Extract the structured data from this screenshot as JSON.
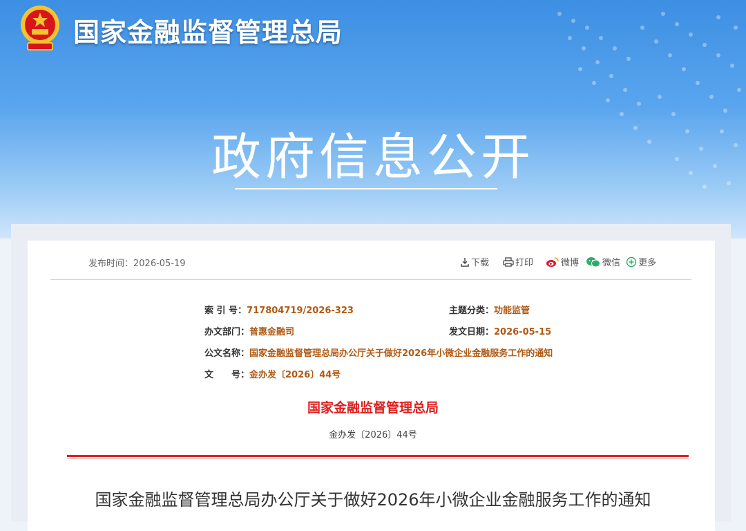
{
  "header": {
    "org_name": "国家金融监督管理总局",
    "section_title": "政府信息公开"
  },
  "meta": {
    "publish_time_label": "发布时间：",
    "publish_time": "2026-05-19"
  },
  "toolbar": {
    "download": "下载",
    "print": "打印",
    "weibo": "微博",
    "wechat": "微信",
    "more": "更多"
  },
  "info": {
    "index_label": "索 引 号：",
    "index_value": "717804719/2026-323",
    "topic_label": "主题分类：",
    "topic_value": "功能监管",
    "dept_label": "办文部门：",
    "dept_value": "普惠金融司",
    "date_label": "发文日期：",
    "date_value": "2026-05-15",
    "name_label": "公文名称：",
    "name_value": "国家金融监督管理总局办公厅关于做好2026年小微企业金融服务工作的通知",
    "docno_label": "文　　号：",
    "docno_value": "金办发〔2026〕44号"
  },
  "document": {
    "issuer": "国家金融监督管理总局",
    "number": "金办发〔2026〕44号",
    "title": "国家金融监督管理总局办公厅关于做好2026年小微企业金融服务工作的通知"
  },
  "colors": {
    "banner_top": "#3d8fe3",
    "issuer_red": "#e01e1e",
    "value_brown": "#b05a14"
  }
}
